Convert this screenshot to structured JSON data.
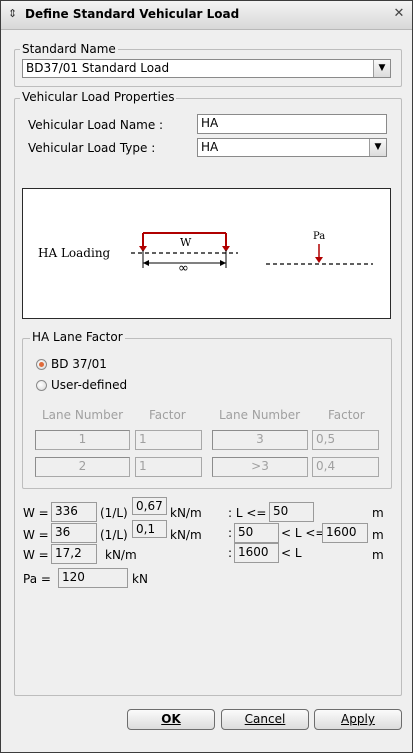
{
  "window": {
    "title": "Define Standard Vehicular Load"
  },
  "standard_name": {
    "legend": "Standard Name",
    "selected": "BD37/01 Standard Load"
  },
  "properties": {
    "legend": "Vehicular Load Properties",
    "name_label": "Vehicular Load Name :",
    "name_value": "HA",
    "type_label": "Vehicular Load Type :",
    "type_value": "HA"
  },
  "diagram": {
    "ha_label": "HA Loading",
    "w_label": "W",
    "infinity": "∞",
    "pa_label": "Pa",
    "colors": {
      "load_arrow": "#b00000"
    }
  },
  "lane_factor": {
    "legend": "HA Lane Factor",
    "options": [
      {
        "label": "BD 37/01",
        "selected": true
      },
      {
        "label": "User-defined",
        "selected": false
      }
    ],
    "headers": {
      "lane_number": "Lane Number",
      "factor": "Factor"
    },
    "rows": [
      {
        "lane_a": "1",
        "factor_a": "1",
        "lane_b": "3",
        "factor_b": "0,5"
      },
      {
        "lane_a": "2",
        "factor_a": "1",
        "lane_b": ">3",
        "factor_b": "0,4"
      }
    ]
  },
  "formulas": {
    "w_eq": "W =",
    "pa_eq": "Pa =",
    "inv_l": "(1/L)",
    "knm": "kN/m",
    "kn": "kN",
    "m": "m",
    "r1": {
      "coef": "336",
      "exp": "0,67",
      "cond": ": L <=",
      "limit": "50"
    },
    "r2": {
      "coef": "36",
      "exp": "0,1",
      "cond_a": ":",
      "lower": "50",
      "cond_b": "< L <=",
      "upper": "1600"
    },
    "r3": {
      "coef": "17,2",
      "cond_a": ":",
      "lower": "1600",
      "cond_b": "< L"
    },
    "pa_value": "120"
  },
  "buttons": {
    "ok": "OK",
    "cancel": "Cancel",
    "apply": "Apply"
  }
}
